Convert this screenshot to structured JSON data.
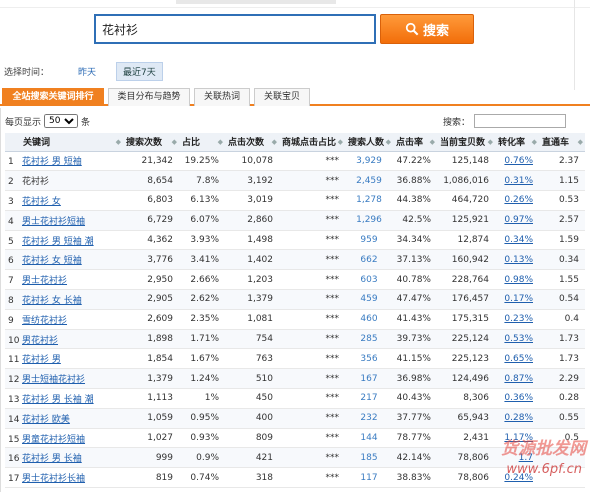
{
  "search": {
    "value": "花衬衫",
    "button_label": "搜索"
  },
  "time": {
    "label": "选择时间：",
    "options": [
      "昨天",
      "最近7天"
    ]
  },
  "tabs": [
    "全站搜索关键词排行",
    "类目分布与趋势",
    "关联热词",
    "关联宝贝"
  ],
  "controls": {
    "per_page_prefix": "每页显示",
    "per_page_value": "50",
    "per_page_suffix": "条",
    "search_label": "搜索："
  },
  "table": {
    "headers": [
      "关键词",
      "搜索次数",
      "占比",
      "点击次数",
      "商城点击占比",
      "搜索人数",
      "点击率",
      "当前宝贝数",
      "转化率",
      "直通车"
    ],
    "rows": [
      [
        "1",
        "花衬衫 男 短袖",
        "21,342",
        "19.25%",
        "10,078",
        "***",
        "3,929",
        "47.22%",
        "125,148",
        "0.76%",
        "2.37"
      ],
      [
        "2",
        "花衬衫",
        "8,654",
        "7.8%",
        "3,192",
        "***",
        "2,459",
        "36.88%",
        "1,086,016",
        "0.31%",
        "1.15"
      ],
      [
        "3",
        "花衬衫 女",
        "6,803",
        "6.13%",
        "3,019",
        "***",
        "1,278",
        "44.38%",
        "464,720",
        "0.26%",
        "0.53"
      ],
      [
        "4",
        "男士花衬衫短袖",
        "6,729",
        "6.07%",
        "2,860",
        "***",
        "1,296",
        "42.5%",
        "125,921",
        "0.97%",
        "2.57"
      ],
      [
        "5",
        "花衬衫 男 短袖 潮",
        "4,362",
        "3.93%",
        "1,498",
        "***",
        "959",
        "34.34%",
        "12,874",
        "0.34%",
        "1.59"
      ],
      [
        "6",
        "花衬衫 女 短袖",
        "3,776",
        "3.41%",
        "1,402",
        "***",
        "662",
        "37.13%",
        "160,942",
        "0.13%",
        "0.34"
      ],
      [
        "7",
        "男士花衬衫",
        "2,950",
        "2.66%",
        "1,203",
        "***",
        "603",
        "40.78%",
        "228,764",
        "0.98%",
        "1.55"
      ],
      [
        "8",
        "花衬衫 女 长袖",
        "2,905",
        "2.62%",
        "1,379",
        "***",
        "459",
        "47.47%",
        "176,457",
        "0.17%",
        "0.54"
      ],
      [
        "9",
        "雪纺花衬衫",
        "2,609",
        "2.35%",
        "1,081",
        "***",
        "460",
        "41.43%",
        "175,315",
        "0.23%",
        "0.4"
      ],
      [
        "10",
        "男花衬衫",
        "1,898",
        "1.71%",
        "754",
        "***",
        "285",
        "39.73%",
        "225,124",
        "0.53%",
        "1.73"
      ],
      [
        "11",
        "花衬衫 男",
        "1,854",
        "1.67%",
        "763",
        "***",
        "356",
        "41.15%",
        "225,123",
        "0.65%",
        "1.73"
      ],
      [
        "12",
        "男士短袖花衬衫",
        "1,379",
        "1.24%",
        "510",
        "***",
        "167",
        "36.98%",
        "124,496",
        "0.87%",
        "2.29"
      ],
      [
        "13",
        "花衬衫 男 长袖 潮",
        "1,113",
        "1%",
        "450",
        "***",
        "217",
        "40.43%",
        "8,306",
        "0.36%",
        "0.28"
      ],
      [
        "14",
        "花衬衫 欧美",
        "1,059",
        "0.95%",
        "400",
        "***",
        "232",
        "37.77%",
        "65,943",
        "0.28%",
        "0.55"
      ],
      [
        "15",
        "男童花衬衫短袖",
        "1,027",
        "0.93%",
        "809",
        "***",
        "144",
        "78.77%",
        "2,431",
        "1.17%",
        "0.5"
      ],
      [
        "16",
        "花衬衫 男 长袖",
        "999",
        "0.9%",
        "421",
        "***",
        "185",
        "42.14%",
        "78,806",
        "1.7",
        ""
      ],
      [
        "17",
        "男士花衬衫长袖",
        "819",
        "0.74%",
        "318",
        "***",
        "117",
        "38.83%",
        "78,806",
        "0.24%",
        ""
      ]
    ]
  },
  "watermark": {
    "main": "货源批发网",
    "sub": "www.6pf.cn"
  },
  "colors": {
    "accent": "#f08020",
    "link": "#1f5fae",
    "search_border": "#2f6fb6"
  }
}
